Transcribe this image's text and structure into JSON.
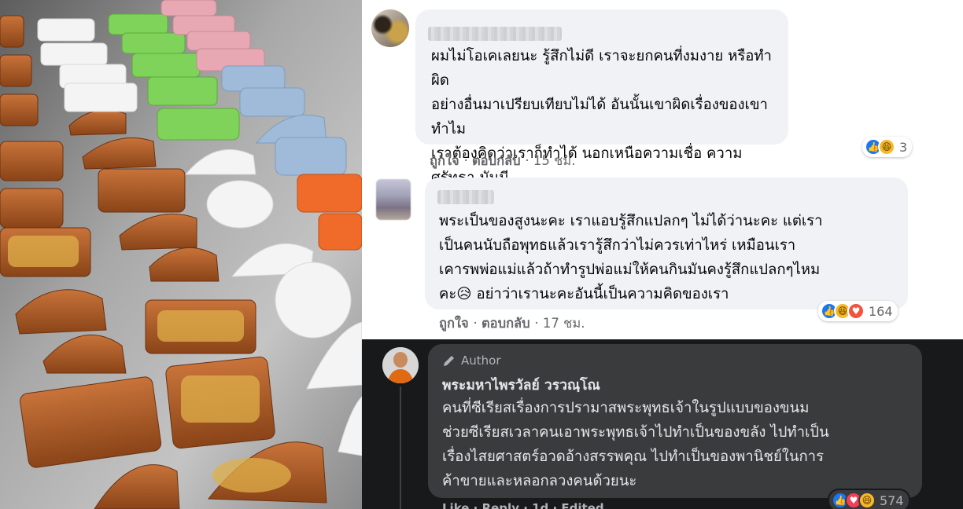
{
  "photo": {
    "description_icon": "amulet-shaped-candy-photo"
  },
  "comments": [
    {
      "author_blurred": true,
      "text": "ผมไม่โอเคเลยนะ รู้สึกไม่ดี เราจะยกคนที่งมงาย หรือทำผิด\nอย่างอื่นมาเปรียบเทียบไม่ได้ อันนั้นเขาผิดเรื่องของเขา ทำไม\nเราต้องคิดว่าเราก็ทำได้ นอกเหนือความเชื่อ ความศรัทธา มันมี\nเรื่องให้เกรียติกัน เรื่องกาลเทศะด้วยครับ",
      "like_label": "ถูกใจ",
      "reply_label": "ตอบกลับ",
      "time": "15 ชม.",
      "reaction_count": "3",
      "reactions": [
        "like-icon",
        "haha-icon"
      ]
    },
    {
      "author_blurred": true,
      "text": "พระเป็นของสูงนะคะ เราแอบรู้สึกแปลกๆ ไม่ได้ว่านะคะ แต่เรา\nเป็นคนนับถือพุทธแล้วเรารู้สึกว่าไม่ควรเท่าไหร่ เหมือนเรา\nเคารพพ่อแม่แล้วถ้าทำรูปพ่อแม่ให้คนกินมันคงรู้สึกแปลกๆไหม\nคะ😥 อย่าว่าเรานะคะอันนี้เป็นความคิดของเรา",
      "like_label": "ถูกใจ",
      "reply_label": "ตอบกลับ",
      "time": "17 ชม.",
      "reaction_count": "164",
      "reactions": [
        "like-icon",
        "haha-icon",
        "care-icon"
      ]
    }
  ],
  "author_reply": {
    "badge": "Author",
    "name": "พระมหาไพรวัลย์ วรวณฺโณ",
    "text": "คนที่ซีเรียสเรื่องการปรามาสพระพุทธเจ้าในรูปแบบของขนม\nช่วยซีเรียสเวลาคนเอาพระพุทธเจ้าไปทำเป็นของขลัง ไปทำเป็น\nเรื่องไสยศาสตร์อวดอ้างสรรพคุณ ไปทำเป็นของพานิชย์ในการ\nค้าขายและหลอกลวงคนด้วยนะ",
    "reaction_count": "574",
    "reactions": [
      "like-icon",
      "love-icon",
      "haha-icon"
    ],
    "meta_partial": "Like · Reply · 1d · Edited"
  },
  "colors": {
    "light_bubble": "#f0f2f5",
    "dark_bg": "#18191a",
    "dark_bubble": "#3a3b3c",
    "like_blue": "#1877f2",
    "haha_yellow": "#f7b928",
    "love_red": "#f33e58"
  }
}
